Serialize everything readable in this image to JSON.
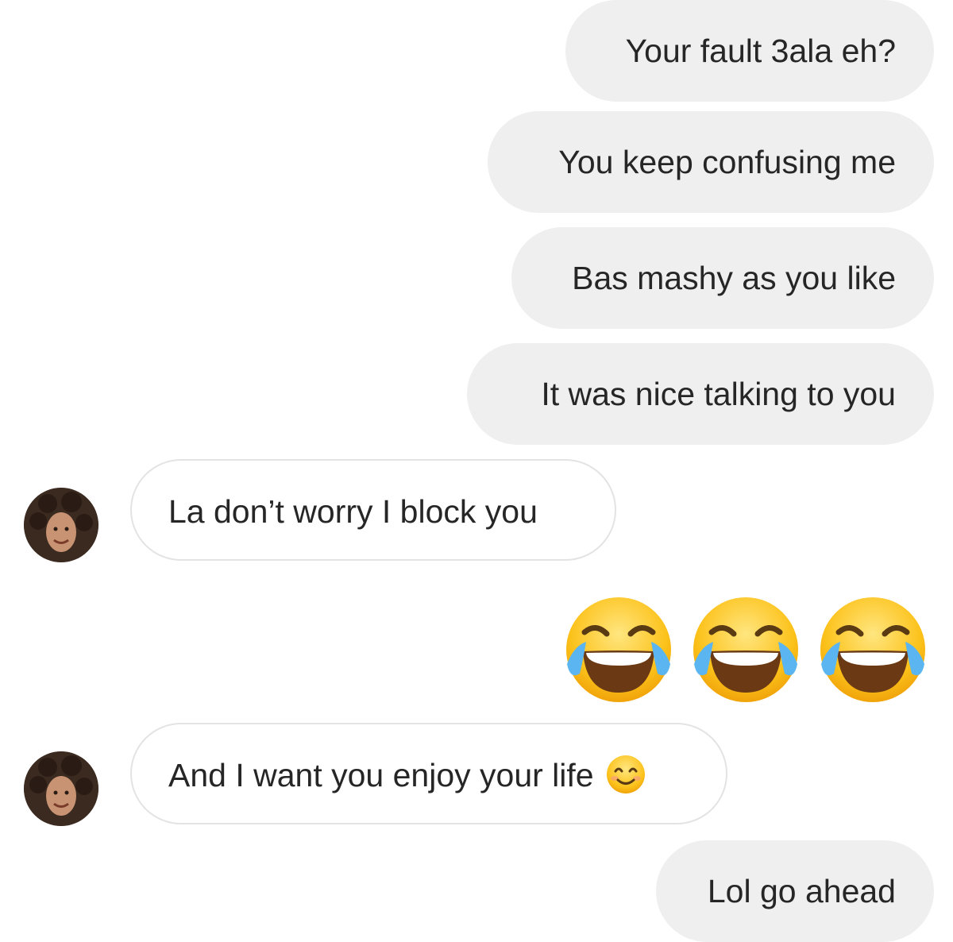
{
  "messages": [
    {
      "direction": "outgoing",
      "text": "Your fault 3ala eh?"
    },
    {
      "direction": "outgoing",
      "text": "You keep confusing me"
    },
    {
      "direction": "outgoing",
      "text": "Bas mashy as you like"
    },
    {
      "direction": "outgoing",
      "text": "It was nice talking to you"
    },
    {
      "direction": "incoming",
      "text": "La don’t worry I block you"
    },
    {
      "direction": "outgoing",
      "emoji": [
        "face-with-tears-of-joy-icon",
        "face-with-tears-of-joy-icon",
        "face-with-tears-of-joy-icon"
      ]
    },
    {
      "direction": "incoming",
      "text": "And I want you enjoy your life",
      "emoji": "smiling-face-with-smiling-eyes-icon"
    },
    {
      "direction": "outgoing",
      "text": "Lol go ahead"
    }
  ],
  "colors": {
    "outgoing_bubble": "#efefef",
    "incoming_bubble": "#ffffff",
    "incoming_border": "#e3e3e3",
    "text": "#262626"
  }
}
